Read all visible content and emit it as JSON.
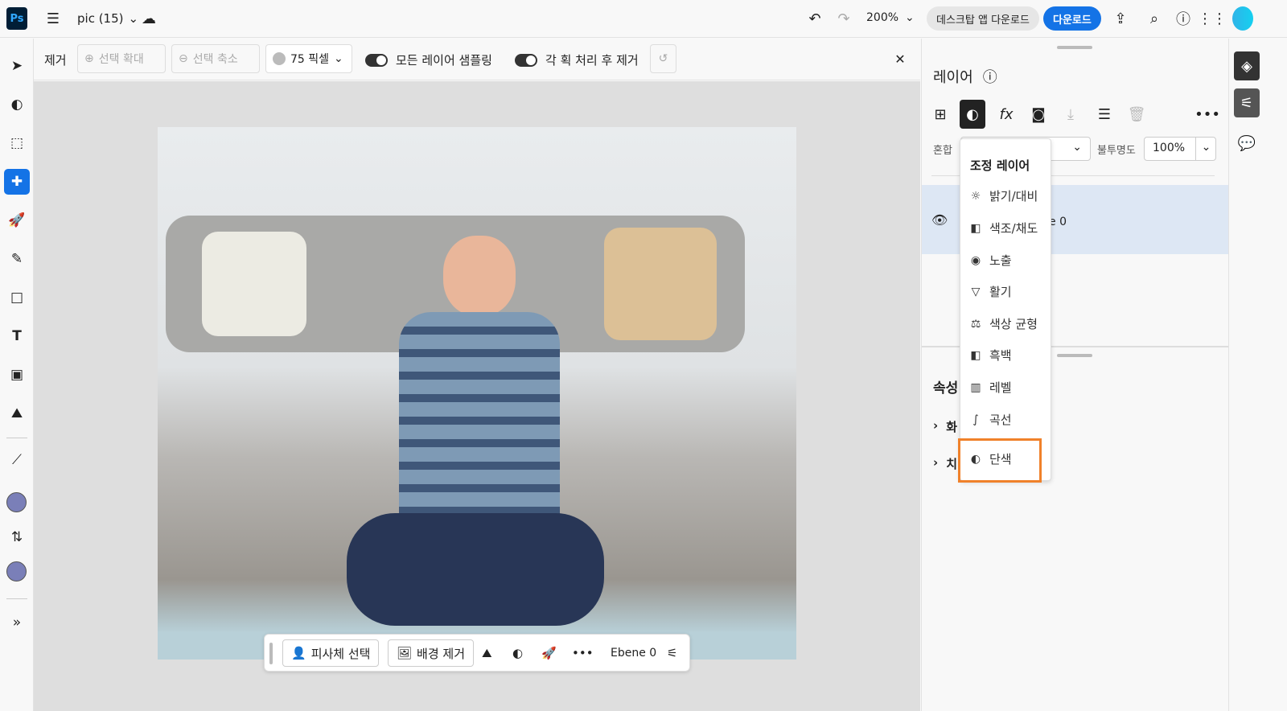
{
  "topbar": {
    "app_logo": "Ps",
    "doc_title": "pic (15)",
    "zoom": "200%",
    "desktop_download": "데스크탑 앱 다운로드",
    "download": "다운로드"
  },
  "options": {
    "tool_name": "제거",
    "expand": "선택 확대",
    "contract": "선택 축소",
    "brush_size": "75 픽셀",
    "sample_all_layers": "모든 레이어 샘플링",
    "remove_after_stroke": "각 획 처리 후 제거"
  },
  "floatbar": {
    "select_subject": "피사체 선택",
    "remove_bg": "배경 제거",
    "layer_name": "Ebene 0"
  },
  "layers": {
    "title": "레이어",
    "blend_label": "혼합",
    "opacity_label": "불투명도",
    "opacity": "100%",
    "layer_name_partial": "e 0"
  },
  "properties": {
    "title": "속성",
    "item1": "화",
    "item2": "치"
  },
  "adjust_menu": {
    "title": "조정 레이어",
    "items": [
      {
        "label": "밝기/대비",
        "icon": "☼"
      },
      {
        "label": "색조/채도",
        "icon": "◧"
      },
      {
        "label": "노출",
        "icon": "◉"
      },
      {
        "label": "활기",
        "icon": "▽"
      },
      {
        "label": "색상 균형",
        "icon": "⚖"
      },
      {
        "label": "흑백",
        "icon": "◧"
      },
      {
        "label": "레벨",
        "icon": "▥"
      },
      {
        "label": "곡선",
        "icon": "∫"
      },
      {
        "label": "단색",
        "icon": "◐"
      }
    ]
  },
  "colors": {
    "accent": "#1473e6",
    "highlight": "#f0812a",
    "swatch": "#7a7fb8"
  }
}
